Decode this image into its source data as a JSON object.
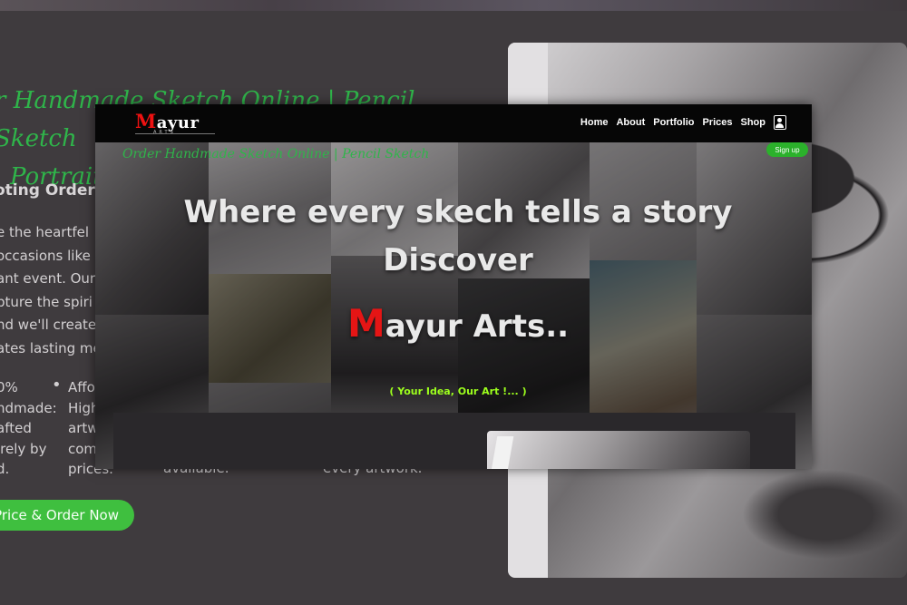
{
  "background": {
    "heading_line1": "r Handmade Sketch Online | Pencil Sketch",
    "heading_line2": "| Portrait",
    "subheading": "oting Order",
    "paragraph_lines": [
      "e the heartfel",
      "occasions like",
      "ant event. Our",
      "pture the spiri",
      "nd we'll create",
      "ates lasting me"
    ],
    "col1": [
      "0%",
      "ndmade:",
      "afted",
      "irely by",
      "d."
    ],
    "col2": [
      "Affo",
      "High",
      "artw",
      "com",
      "prices."
    ],
    "col3": "available.",
    "col4": "every artwork.",
    "cta_label": "Price & Order Now"
  },
  "site": {
    "logo_name": "ayur",
    "logo_initial": "M",
    "logo_sub": "ARTS",
    "nav": [
      "Home",
      "About",
      "Portfolio",
      "Prices",
      "Shop"
    ],
    "signup_label": "Sign up",
    "hero": {
      "line1": "Where every skech tells a story",
      "line2": "Discover",
      "line3_initial": "M",
      "line3_rest": "ayur Arts..",
      "tagline": "( Your Idea, Our Art !... )"
    },
    "lower_title": "Order Handmade Sketch Online | Pencil Sketch"
  },
  "colors": {
    "accent_green": "#2fb54a",
    "brand_red": "#e51515",
    "tagline_green": "#9dff1d"
  },
  "icons": [
    "user-icon"
  ]
}
